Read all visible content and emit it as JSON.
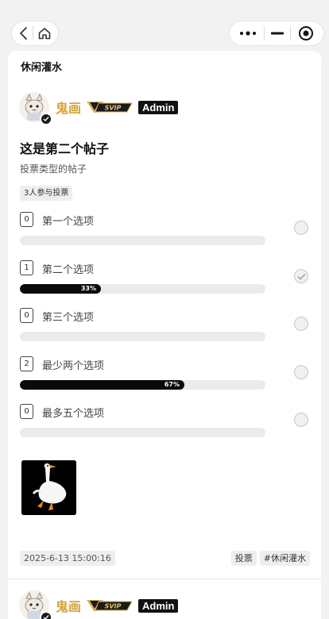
{
  "section_title": "休闲灌水",
  "post": {
    "author": {
      "name": "鬼画",
      "vip_label": "SVIP",
      "role": "Admin"
    },
    "title": "这是第二个帖子",
    "description": "投票类型的帖子",
    "participants_label": "3人参与投票",
    "options": [
      {
        "count": "0",
        "label": "第一个选项",
        "percent": 0,
        "percent_label": "",
        "selected": false
      },
      {
        "count": "1",
        "label": "第二个选项",
        "percent": 33,
        "percent_label": "33%",
        "selected": true
      },
      {
        "count": "0",
        "label": "第三个选项",
        "percent": 0,
        "percent_label": "",
        "selected": false
      },
      {
        "count": "2",
        "label": "最少两个选项",
        "percent": 67,
        "percent_label": "67%",
        "selected": false
      },
      {
        "count": "0",
        "label": "最多五个选项",
        "percent": 0,
        "percent_label": "",
        "selected": false
      }
    ],
    "date": "2025-6-13 15:00:16",
    "tags": [
      "投票",
      "#休闲灌水"
    ]
  },
  "next_post": {
    "author": {
      "name": "鬼画",
      "vip_label": "SVIP",
      "role": "Admin"
    }
  },
  "colors": {
    "username": "#d4a53a",
    "progress_fill": "#0a0a0a",
    "progress_track": "#ebebeb"
  },
  "icons": {
    "back": "chevron-left-icon",
    "home": "home-icon",
    "more": "more-dots-icon",
    "minimize": "minimize-icon",
    "close": "record-circle-icon"
  }
}
